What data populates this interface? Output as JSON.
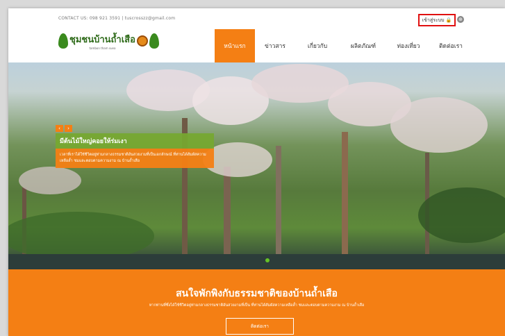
{
  "topbar": {
    "contact": "CONTACT US: 098 921 3591 | tuscrosszz@gmail.com",
    "login_label": "เข้าสู่ระบบ",
    "login_icon": "lock-icon",
    "language_icon": "globe-icon"
  },
  "brand": {
    "name": "ชุมชนบ้านถ้ำเสือ",
    "tagline": "tambon tham suea"
  },
  "nav": {
    "items": [
      {
        "label": "หน้าแรก",
        "active": true
      },
      {
        "label": "ข่าวสาร",
        "active": false
      },
      {
        "label": "เกี่ยวกับ",
        "active": false
      },
      {
        "label": "ผลิตภัณฑ์",
        "active": false
      },
      {
        "label": "ท่องเที่ยว",
        "active": false
      },
      {
        "label": "ติดต่อเรา",
        "active": false
      }
    ]
  },
  "hero": {
    "prev": "‹",
    "next": "›",
    "title": "มีต้นไม้ใหญ่คอยให้ร่มเงา",
    "body": "เวลาที่เราได้ใช้ชีวิตอยู่ท่ามกลางธรรมชาติอันสวยงามที่เป็นเอกลักษณ์ ที่ท่านได้สัมผัสความเหลือล้ำ ชมและตอบตามความงาม ณ บ้านถ้ำเสือ"
  },
  "cta": {
    "title": "สนใจพักพิงกับธรรมชาติของบ้านถ้ำเสือ",
    "subtitle": "หากท่านที่ซึ่งได้ใช้ชีวิตอยู่ท่ามกลางธรรมชาติอันสวยงามที่เป็น ที่ท่านได้สัมผัสความเหลือล้ำ ชมและตอบตามความงาม ณ บ้านถ้ำเสือ",
    "button": "ติดต่อเรา"
  },
  "colors": {
    "accent": "#f47f14",
    "caption_green": "#76a830",
    "highlight_red": "#e01010"
  }
}
